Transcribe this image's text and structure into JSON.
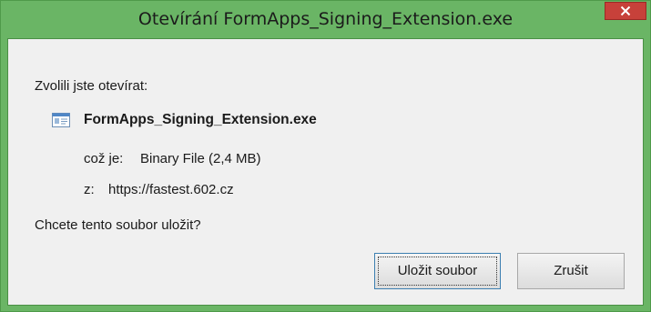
{
  "window": {
    "title": "Otevírání FormApps_Signing_Extension.exe",
    "close_icon": "close-icon",
    "accent_color": "#6ab565",
    "close_color": "#c7413a"
  },
  "content": {
    "prompt": "Zvolili jste otevírat:",
    "file": {
      "icon": "executable-file-icon",
      "name": "FormApps_Signing_Extension.exe",
      "type_label": "což je:",
      "type_value": "Binary File (2,4 MB)",
      "from_label": "z:",
      "from_value": "https://fastest.602.cz"
    },
    "question": "Chcete tento soubor uložit?"
  },
  "buttons": {
    "save_label": "Uložit soubor",
    "cancel_label": "Zrušit"
  }
}
